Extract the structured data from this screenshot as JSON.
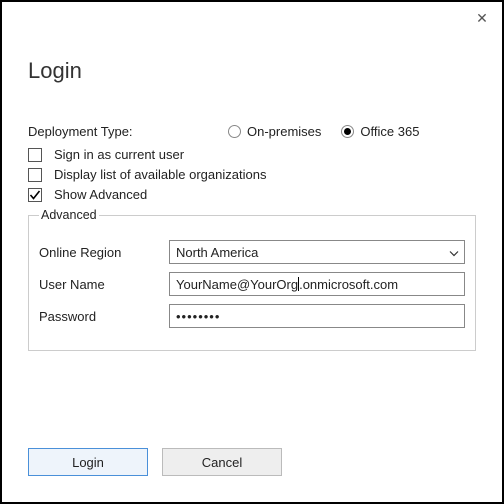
{
  "title": "Login",
  "close_glyph": "✕",
  "deployment": {
    "label": "Deployment Type:",
    "options": {
      "onprem": "On-premises",
      "o365": "Office 365"
    },
    "selected": "o365"
  },
  "checks": {
    "sign_in_current": {
      "label": "Sign in as current user",
      "checked": false
    },
    "display_orgs": {
      "label": "Display list of available organizations",
      "checked": false
    },
    "show_advanced": {
      "label": "Show Advanced",
      "checked": true
    }
  },
  "advanced": {
    "legend": "Advanced",
    "region_label": "Online Region",
    "region_value": "North America",
    "username_label": "User Name",
    "username_value_a": "YourName@YourOrg",
    "username_value_b": ".onmicrosoft.com",
    "password_label": "Password",
    "password_mask": "••••••••"
  },
  "buttons": {
    "login": "Login",
    "cancel": "Cancel"
  }
}
